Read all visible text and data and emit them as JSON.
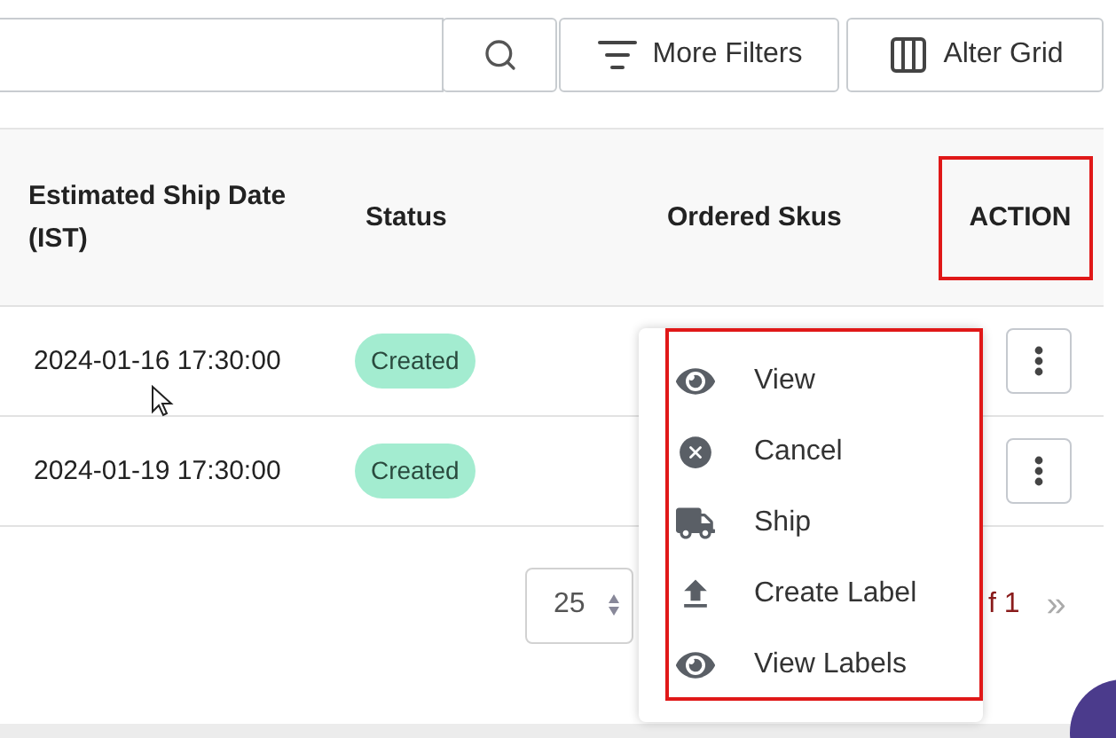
{
  "toolbar": {
    "buttons": [
      {
        "kind": "search"
      },
      {
        "kind": "filter",
        "label": "More Filters"
      },
      {
        "kind": "grid",
        "label": "Alter Grid"
      }
    ]
  },
  "table": {
    "columns": [
      "Estimated Ship Date (IST)",
      "Status",
      "Ordered Skus",
      "ACTION"
    ],
    "rows": [
      {
        "ship_date": "2024-01-16 17:30:00",
        "status": "Created"
      },
      {
        "ship_date": "2024-01-19 17:30:00",
        "status": "Created"
      }
    ]
  },
  "action_menu": {
    "items": [
      {
        "kind": "eye",
        "label": "View"
      },
      {
        "kind": "cancel",
        "label": "Cancel"
      },
      {
        "kind": "truck",
        "label": "Ship"
      },
      {
        "kind": "upload",
        "label": "Create Label"
      },
      {
        "kind": "eye",
        "label": "View Labels"
      }
    ]
  },
  "pagination": {
    "page_size": "25",
    "page_text": "f 1",
    "next": "»"
  }
}
